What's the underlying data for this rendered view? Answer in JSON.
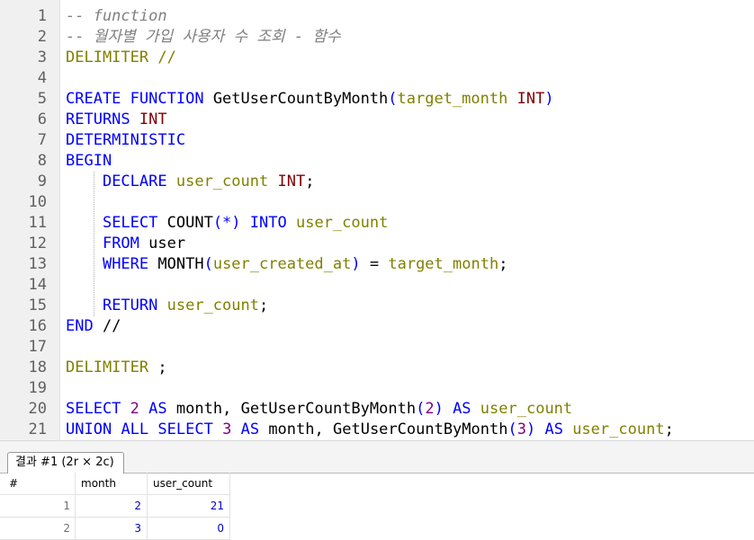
{
  "editor": {
    "line_numbers": [
      "1",
      "2",
      "3",
      "4",
      "5",
      "6",
      "7",
      "8",
      "9",
      "10",
      "11",
      "12",
      "13",
      "14",
      "15",
      "16",
      "17",
      "18",
      "19",
      "20",
      "21"
    ],
    "line1": {
      "comment": "-- function"
    },
    "line2": {
      "comment": "-- 월자별 가입 사용자 수 조회 - 함수"
    },
    "line3": {
      "kw": "DELIMITER",
      "rest": " //"
    },
    "line5": {
      "kw1": "CREATE",
      "kw2": "FUNCTION",
      "fname": "GetUserCountByMonth",
      "p1": "(",
      "param": "target_month",
      "type": "INT",
      "p2": ")"
    },
    "line6": {
      "kw": "RETURNS",
      "type": "INT"
    },
    "line7": {
      "kw": "DETERMINISTIC"
    },
    "line8": {
      "kw": "BEGIN"
    },
    "line9": {
      "kw": "DECLARE",
      "var": "user_count",
      "type": "INT",
      "end": ";"
    },
    "line11": {
      "kw1": "SELECT",
      "fn": "COUNT",
      "p1": "(*)",
      "kw2": "INTO",
      "var": "user_count"
    },
    "line12": {
      "kw": "FROM",
      "tbl": "user"
    },
    "line13": {
      "kw": "WHERE",
      "fn": "MONTH",
      "p1": "(",
      "col": "user_created_at",
      "p2": ")",
      "eq": "=",
      "var": "target_month",
      "end": ";"
    },
    "line15": {
      "kw": "RETURN",
      "var": "user_count",
      "end": ";"
    },
    "line16": {
      "kw": "END",
      "rest": " //"
    },
    "line18": {
      "kw": "DELIMITER",
      "rest": " ;"
    },
    "line20": {
      "kw1": "SELECT",
      "n": "2",
      "kw2": "AS",
      "alias": "month",
      "comma": ",",
      "fname": "GetUserCountByMonth",
      "p1": "(",
      "arg": "2",
      "p2": ")",
      "kw3": "AS",
      "alias2": "user_count"
    },
    "line21": {
      "kw1": "UNION",
      "kw2": "ALL",
      "kw3": "SELECT",
      "n": "3",
      "kw4": "AS",
      "alias": "month",
      "comma": ",",
      "fname": "GetUserCountByMonth",
      "p1": "(",
      "arg": "3",
      "p2": ")",
      "kw5": "AS",
      "alias2": "user_count",
      "end": ";"
    }
  },
  "results": {
    "tab_label": "결과 #1 (2r × 2c)",
    "columns": [
      "#",
      "month",
      "user_count"
    ],
    "rows": [
      {
        "num": "1",
        "month": "2",
        "user_count": "21"
      },
      {
        "num": "2",
        "month": "3",
        "user_count": "0"
      }
    ]
  }
}
